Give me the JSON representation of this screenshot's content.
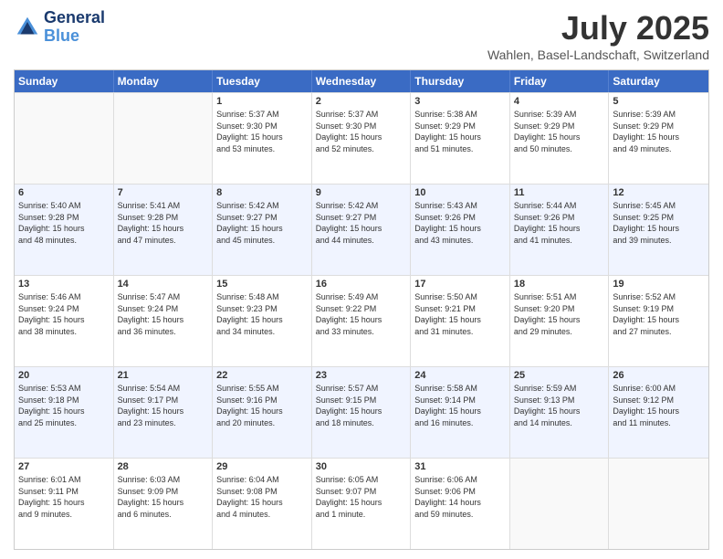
{
  "header": {
    "logo_line1": "General",
    "logo_line2": "Blue",
    "month": "July 2025",
    "location": "Wahlen, Basel-Landschaft, Switzerland"
  },
  "days_of_week": [
    "Sunday",
    "Monday",
    "Tuesday",
    "Wednesday",
    "Thursday",
    "Friday",
    "Saturday"
  ],
  "weeks": [
    [
      {
        "day": "",
        "info": ""
      },
      {
        "day": "",
        "info": ""
      },
      {
        "day": "1",
        "info": "Sunrise: 5:37 AM\nSunset: 9:30 PM\nDaylight: 15 hours\nand 53 minutes."
      },
      {
        "day": "2",
        "info": "Sunrise: 5:37 AM\nSunset: 9:30 PM\nDaylight: 15 hours\nand 52 minutes."
      },
      {
        "day": "3",
        "info": "Sunrise: 5:38 AM\nSunset: 9:29 PM\nDaylight: 15 hours\nand 51 minutes."
      },
      {
        "day": "4",
        "info": "Sunrise: 5:39 AM\nSunset: 9:29 PM\nDaylight: 15 hours\nand 50 minutes."
      },
      {
        "day": "5",
        "info": "Sunrise: 5:39 AM\nSunset: 9:29 PM\nDaylight: 15 hours\nand 49 minutes."
      }
    ],
    [
      {
        "day": "6",
        "info": "Sunrise: 5:40 AM\nSunset: 9:28 PM\nDaylight: 15 hours\nand 48 minutes."
      },
      {
        "day": "7",
        "info": "Sunrise: 5:41 AM\nSunset: 9:28 PM\nDaylight: 15 hours\nand 47 minutes."
      },
      {
        "day": "8",
        "info": "Sunrise: 5:42 AM\nSunset: 9:27 PM\nDaylight: 15 hours\nand 45 minutes."
      },
      {
        "day": "9",
        "info": "Sunrise: 5:42 AM\nSunset: 9:27 PM\nDaylight: 15 hours\nand 44 minutes."
      },
      {
        "day": "10",
        "info": "Sunrise: 5:43 AM\nSunset: 9:26 PM\nDaylight: 15 hours\nand 43 minutes."
      },
      {
        "day": "11",
        "info": "Sunrise: 5:44 AM\nSunset: 9:26 PM\nDaylight: 15 hours\nand 41 minutes."
      },
      {
        "day": "12",
        "info": "Sunrise: 5:45 AM\nSunset: 9:25 PM\nDaylight: 15 hours\nand 39 minutes."
      }
    ],
    [
      {
        "day": "13",
        "info": "Sunrise: 5:46 AM\nSunset: 9:24 PM\nDaylight: 15 hours\nand 38 minutes."
      },
      {
        "day": "14",
        "info": "Sunrise: 5:47 AM\nSunset: 9:24 PM\nDaylight: 15 hours\nand 36 minutes."
      },
      {
        "day": "15",
        "info": "Sunrise: 5:48 AM\nSunset: 9:23 PM\nDaylight: 15 hours\nand 34 minutes."
      },
      {
        "day": "16",
        "info": "Sunrise: 5:49 AM\nSunset: 9:22 PM\nDaylight: 15 hours\nand 33 minutes."
      },
      {
        "day": "17",
        "info": "Sunrise: 5:50 AM\nSunset: 9:21 PM\nDaylight: 15 hours\nand 31 minutes."
      },
      {
        "day": "18",
        "info": "Sunrise: 5:51 AM\nSunset: 9:20 PM\nDaylight: 15 hours\nand 29 minutes."
      },
      {
        "day": "19",
        "info": "Sunrise: 5:52 AM\nSunset: 9:19 PM\nDaylight: 15 hours\nand 27 minutes."
      }
    ],
    [
      {
        "day": "20",
        "info": "Sunrise: 5:53 AM\nSunset: 9:18 PM\nDaylight: 15 hours\nand 25 minutes."
      },
      {
        "day": "21",
        "info": "Sunrise: 5:54 AM\nSunset: 9:17 PM\nDaylight: 15 hours\nand 23 minutes."
      },
      {
        "day": "22",
        "info": "Sunrise: 5:55 AM\nSunset: 9:16 PM\nDaylight: 15 hours\nand 20 minutes."
      },
      {
        "day": "23",
        "info": "Sunrise: 5:57 AM\nSunset: 9:15 PM\nDaylight: 15 hours\nand 18 minutes."
      },
      {
        "day": "24",
        "info": "Sunrise: 5:58 AM\nSunset: 9:14 PM\nDaylight: 15 hours\nand 16 minutes."
      },
      {
        "day": "25",
        "info": "Sunrise: 5:59 AM\nSunset: 9:13 PM\nDaylight: 15 hours\nand 14 minutes."
      },
      {
        "day": "26",
        "info": "Sunrise: 6:00 AM\nSunset: 9:12 PM\nDaylight: 15 hours\nand 11 minutes."
      }
    ],
    [
      {
        "day": "27",
        "info": "Sunrise: 6:01 AM\nSunset: 9:11 PM\nDaylight: 15 hours\nand 9 minutes."
      },
      {
        "day": "28",
        "info": "Sunrise: 6:03 AM\nSunset: 9:09 PM\nDaylight: 15 hours\nand 6 minutes."
      },
      {
        "day": "29",
        "info": "Sunrise: 6:04 AM\nSunset: 9:08 PM\nDaylight: 15 hours\nand 4 minutes."
      },
      {
        "day": "30",
        "info": "Sunrise: 6:05 AM\nSunset: 9:07 PM\nDaylight: 15 hours\nand 1 minute."
      },
      {
        "day": "31",
        "info": "Sunrise: 6:06 AM\nSunset: 9:06 PM\nDaylight: 14 hours\nand 59 minutes."
      },
      {
        "day": "",
        "info": ""
      },
      {
        "day": "",
        "info": ""
      }
    ]
  ]
}
